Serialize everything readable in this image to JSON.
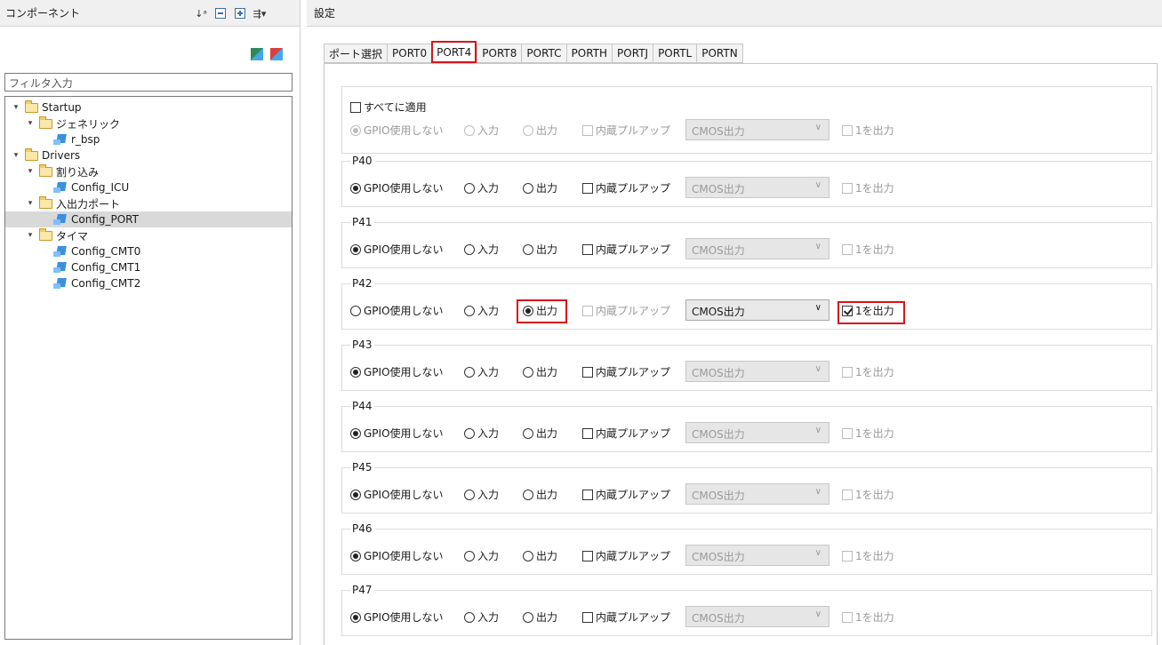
{
  "left_panel": {
    "title": "コンポーネント",
    "filter_placeholder": "フィルタ入力",
    "tree": [
      {
        "label": "Startup",
        "type": "folder",
        "level": 0,
        "expanded": true
      },
      {
        "label": "ジェネリック",
        "type": "folder",
        "level": 1,
        "expanded": true
      },
      {
        "label": "r_bsp",
        "type": "component",
        "level": 2
      },
      {
        "label": "Drivers",
        "type": "folder",
        "level": 0,
        "expanded": true
      },
      {
        "label": "割り込み",
        "type": "folder",
        "level": 1,
        "expanded": true
      },
      {
        "label": "Config_ICU",
        "type": "component",
        "level": 2
      },
      {
        "label": "入出力ポート",
        "type": "folder",
        "level": 1,
        "expanded": true
      },
      {
        "label": "Config_PORT",
        "type": "component",
        "level": 2,
        "selected": true
      },
      {
        "label": "タイマ",
        "type": "folder",
        "level": 1,
        "expanded": true
      },
      {
        "label": "Config_CMT0",
        "type": "component",
        "level": 2
      },
      {
        "label": "Config_CMT1",
        "type": "component",
        "level": 2
      },
      {
        "label": "Config_CMT2",
        "type": "component",
        "level": 2
      }
    ]
  },
  "right_panel": {
    "title": "設定",
    "tabs": [
      "ポート選択",
      "PORT0",
      "PORT4",
      "PORT8",
      "PORTC",
      "PORTH",
      "PORTJ",
      "PORTL",
      "PORTN"
    ],
    "active_tab": "PORT4",
    "apply_all": {
      "label": "すべてに適用",
      "options": {
        "gpio_none": "GPIO使用しない",
        "input": "入力",
        "output": "出力",
        "pullup": "内蔵プルアップ",
        "mode": "CMOS出力",
        "output1": "1を出力"
      }
    },
    "pins": [
      {
        "name": "P40",
        "gpio_none": "GPIO使用しない",
        "input": "入力",
        "output": "出力",
        "pullup": "内蔵プルアップ",
        "mode": "CMOS出力",
        "output1": "1を出力",
        "selected": "gpio_none"
      },
      {
        "name": "P41",
        "gpio_none": "GPIO使用しない",
        "input": "入力",
        "output": "出力",
        "pullup": "内蔵プルアップ",
        "mode": "CMOS出力",
        "output1": "1を出力",
        "selected": "gpio_none"
      },
      {
        "name": "P42",
        "gpio_none": "GPIO使用しない",
        "input": "入力",
        "output": "出力",
        "pullup": "内蔵プルアップ",
        "mode": "CMOS出力",
        "output1": "1を出力",
        "selected": "output",
        "output1_checked": true
      },
      {
        "name": "P43",
        "gpio_none": "GPIO使用しない",
        "input": "入力",
        "output": "出力",
        "pullup": "内蔵プルアップ",
        "mode": "CMOS出力",
        "output1": "1を出力",
        "selected": "gpio_none"
      },
      {
        "name": "P44",
        "gpio_none": "GPIO使用しない",
        "input": "入力",
        "output": "出力",
        "pullup": "内蔵プルアップ",
        "mode": "CMOS出力",
        "output1": "1を出力",
        "selected": "gpio_none"
      },
      {
        "name": "P45",
        "gpio_none": "GPIO使用しない",
        "input": "入力",
        "output": "出力",
        "pullup": "内蔵プルアップ",
        "mode": "CMOS出力",
        "output1": "1を出力",
        "selected": "gpio_none"
      },
      {
        "name": "P46",
        "gpio_none": "GPIO使用しない",
        "input": "入力",
        "output": "出力",
        "pullup": "内蔵プルアップ",
        "mode": "CMOS出力",
        "output1": "1を出力",
        "selected": "gpio_none"
      },
      {
        "name": "P47",
        "gpio_none": "GPIO使用しない",
        "input": "入力",
        "output": "出力",
        "pullup": "内蔵プルアップ",
        "mode": "CMOS出力",
        "output1": "1を出力",
        "selected": "gpio_none"
      }
    ]
  },
  "colors": {
    "highlight": "#d6151b",
    "selection": "#d9d9d9"
  }
}
